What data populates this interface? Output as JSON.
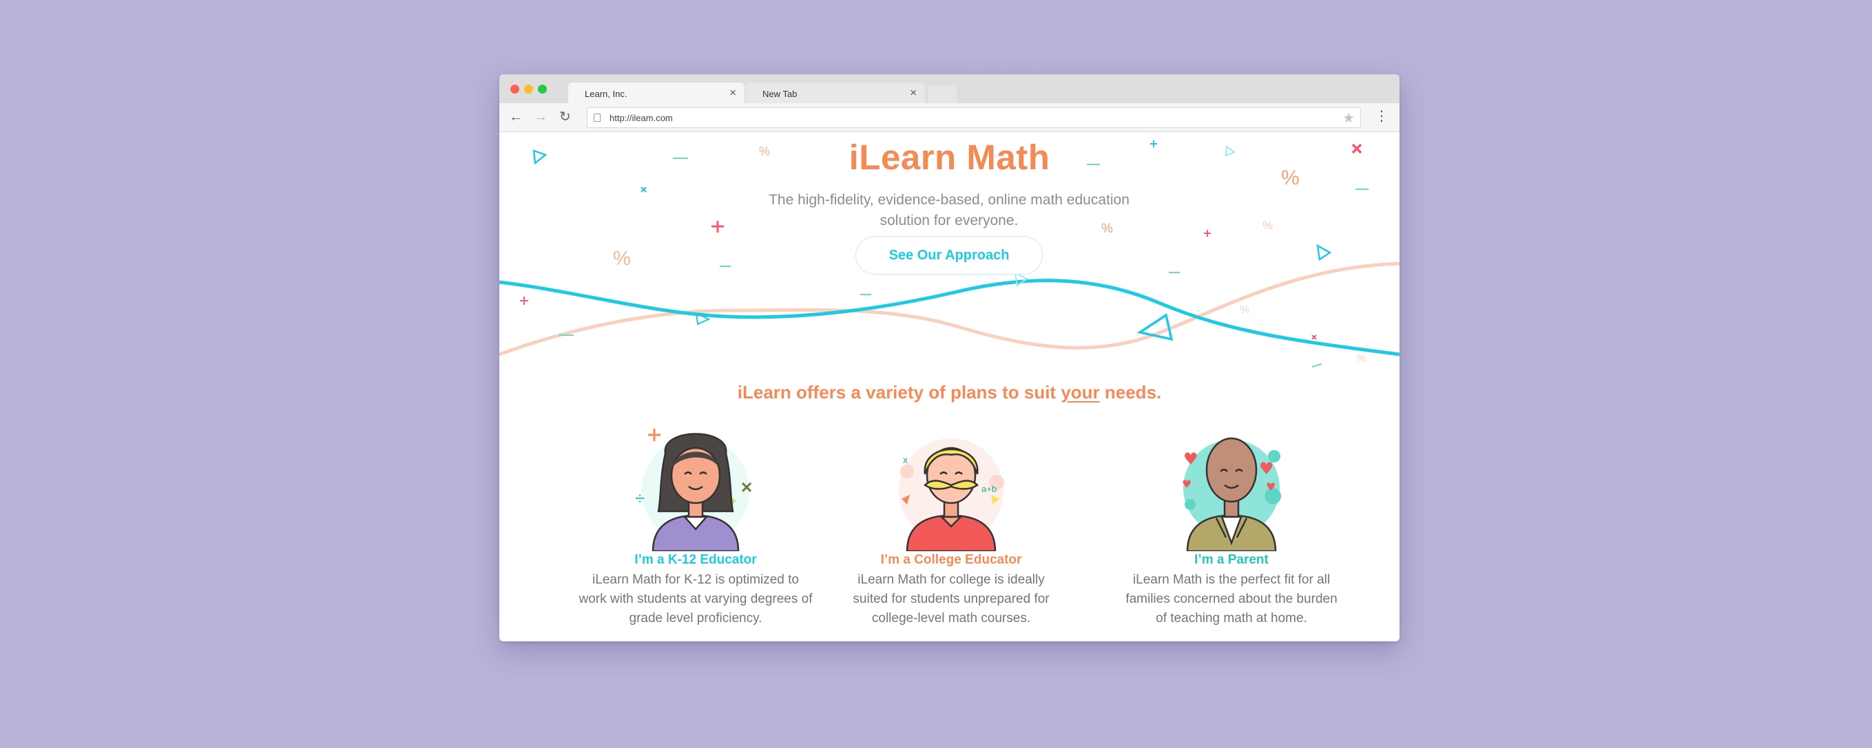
{
  "browser": {
    "tabs": [
      {
        "label": "Learn, Inc.",
        "active": true
      },
      {
        "label": "New Tab",
        "active": false
      }
    ],
    "url": "http://ileam.com",
    "icons": [
      "back-arrow-icon",
      "forward-arrow-icon",
      "reload-icon",
      "page-icon",
      "star-icon",
      "menu-icon",
      "close-icon"
    ]
  },
  "hero": {
    "title": "iLearn Math",
    "subtitle_line1": "The high-fidelity, evidence-based, online math education",
    "subtitle_line2": "solution for everyone.",
    "cta": "See Our Approach"
  },
  "plans": {
    "heading_before": "iLearn offers a variety of plans to suit ",
    "heading_emphasis": "your",
    "heading_after": " needs.",
    "personas": [
      {
        "title": "I’m a K-12 Educator",
        "lines": [
          "iLearn Math for K-12 is optimized to",
          "work with students at varying degrees of",
          "grade level proficiency."
        ]
      },
      {
        "title": "I’m a College Educator",
        "lines": [
          "iLearn Math for college is ideally",
          "suited for students unprepared for",
          "college-level math courses."
        ]
      },
      {
        "title": "I’m a Parent",
        "lines": [
          "iLearn Math is the perfect fit for all",
          "families concerned about the burden",
          "of teaching math at home."
        ]
      }
    ]
  },
  "colors": {
    "background": "#b8b3d8",
    "accent_orange": "#f48a56",
    "accent_cyan": "#1ec9e3",
    "accent_teal": "#22c7b8",
    "wave_peach": "#f8d0bd",
    "symbol_pink": "#f25a76"
  }
}
